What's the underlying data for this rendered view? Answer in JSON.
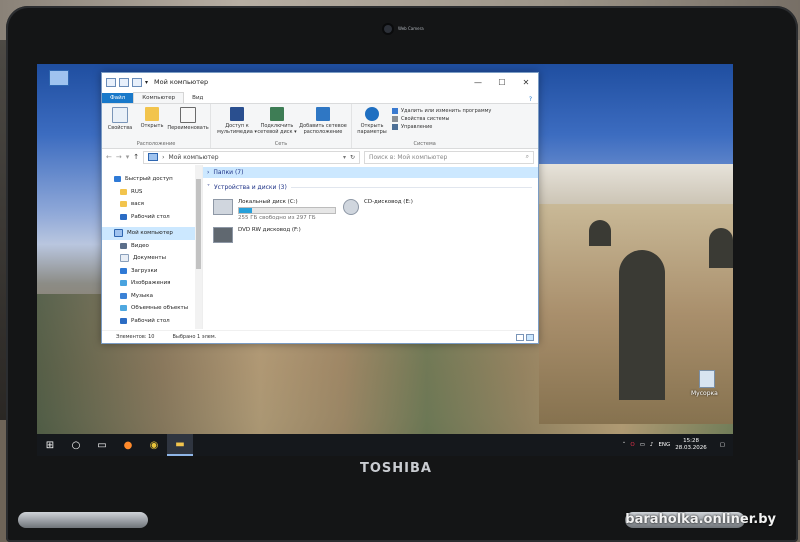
{
  "camera_label": "Web Camera",
  "laptop_brand": "TOSHIBA",
  "watermark": "baraholka.onliner.by",
  "desktop": {
    "recycle_bin_label": "Мусорка"
  },
  "window": {
    "title": "Мой компьютер",
    "controls": {
      "minimize": "—",
      "maximize": "☐",
      "close": "✕",
      "help": "?"
    },
    "ribbon_tabs": [
      "Файл",
      "Компьютер",
      "Вид"
    ],
    "ribbon": {
      "location": {
        "label": "Расположение",
        "buttons": [
          "Свойства",
          "Открыть",
          "Переименовать"
        ]
      },
      "network": {
        "label": "Сеть",
        "buttons": [
          "Доступ к мультимедиа ▾",
          "Подключить сетевой диск ▾",
          "Добавить сетевое расположение"
        ]
      },
      "system": {
        "label": "Система",
        "open_settings": "Открыть параметры",
        "items": [
          "Удалить или изменить программу",
          "Свойства системы",
          "Управление"
        ]
      }
    },
    "address": {
      "path": "Мой компьютер",
      "search_placeholder": "Поиск в: Мой компьютер"
    },
    "nav": {
      "quick_access": "Быстрый доступ",
      "pinned": [
        "RUS",
        "вася",
        "Рабочий стол"
      ],
      "this_pc": "Мой компьютер",
      "children": [
        "Видео",
        "Документы",
        "Загрузки",
        "Изображения",
        "Музыка",
        "Объемные объекты",
        "Рабочий стол"
      ]
    },
    "groups": {
      "folders": "Папки (7)",
      "devices": "Устройства и диски (3)"
    },
    "drives": [
      {
        "name": "Локальный диск (C:)",
        "free": "255 ГБ свободно из 297 ГБ",
        "used_fraction": 0.14
      },
      {
        "name": "CD-дисковод (E:)"
      },
      {
        "name": "DVD RW дисковод (F:)"
      }
    ],
    "status": {
      "items": "Элементов: 10",
      "selected": "Выбрано 1 элем."
    }
  },
  "taskbar": {
    "lang": "ENG",
    "time": "15:28",
    "date": "28.03.2026"
  }
}
